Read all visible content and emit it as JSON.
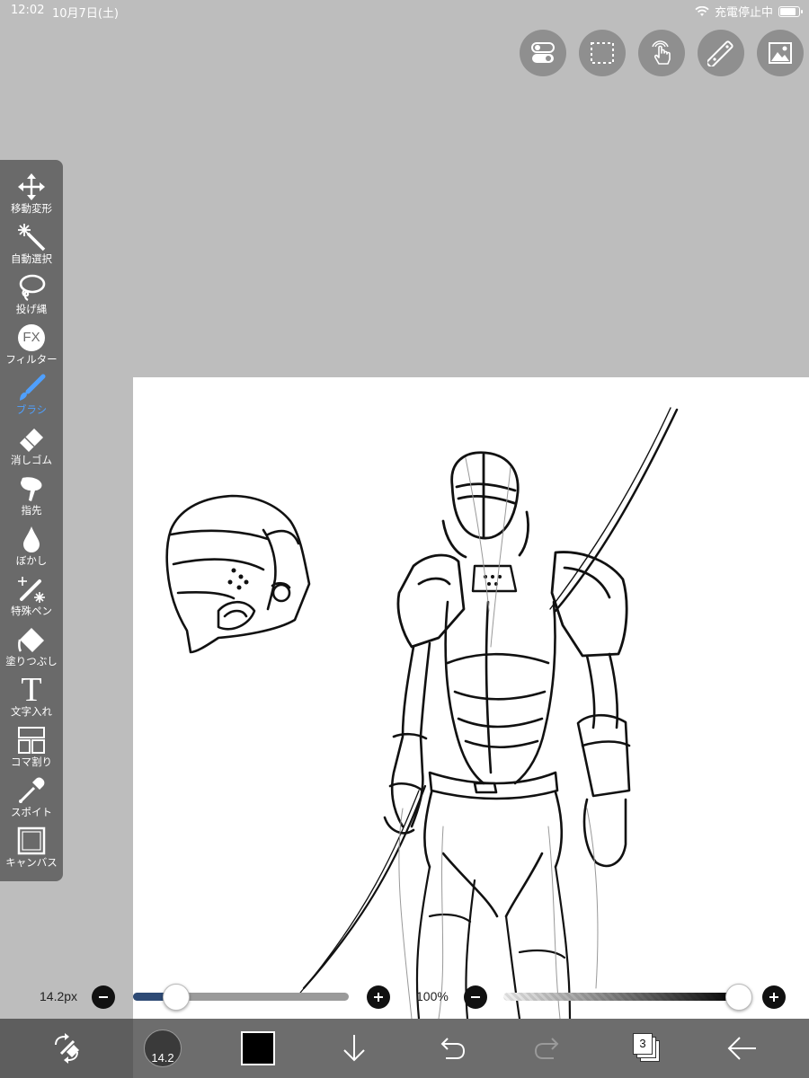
{
  "status_bar": {
    "time": "12:02",
    "date": "10月7日(土)",
    "charging": "充電停止中"
  },
  "top_buttons": [
    "toggle-icon",
    "selection-icon",
    "gesture-icon",
    "ruler-icon",
    "image-icon"
  ],
  "tools": [
    {
      "label": "移動変形",
      "icon": "move-icon",
      "active": false
    },
    {
      "label": "自動選択",
      "icon": "magic-wand-icon",
      "active": false
    },
    {
      "label": "投げ縄",
      "icon": "lasso-icon",
      "active": false
    },
    {
      "label": "フィルター",
      "icon": "fx-icon",
      "icon_text": "FX",
      "active": false
    },
    {
      "label": "ブラシ",
      "icon": "brush-icon",
      "active": true
    },
    {
      "label": "消しゴム",
      "icon": "eraser-icon",
      "active": false
    },
    {
      "label": "指先",
      "icon": "smudge-icon",
      "active": false
    },
    {
      "label": "ぼかし",
      "icon": "blur-drop-icon",
      "active": false
    },
    {
      "label": "特殊ペン",
      "icon": "special-pen-icon",
      "active": false
    },
    {
      "label": "塗りつぶし",
      "icon": "bucket-icon",
      "active": false
    },
    {
      "label": "文字入れ",
      "icon": "text-icon",
      "icon_text": "T",
      "active": false
    },
    {
      "label": "コマ割り",
      "icon": "frame-divider-icon",
      "active": false
    },
    {
      "label": "スポイト",
      "icon": "eyedropper-icon",
      "active": false
    },
    {
      "label": "キャンバス",
      "icon": "canvas-icon",
      "active": false
    }
  ],
  "brush_size": {
    "label": "14.2px",
    "value": 14.2,
    "fraction": 0.2
  },
  "opacity": {
    "label": "100%",
    "value": 100
  },
  "bottom_bar": {
    "brush_preview_text": "14.2",
    "current_color": "#000000",
    "layer_count": "3"
  },
  "colors": {
    "background": "#bdbdbd",
    "toolbar": "#6a6a6a",
    "accent": "#4fa0ff",
    "slider_fill": "#2e4a75"
  }
}
